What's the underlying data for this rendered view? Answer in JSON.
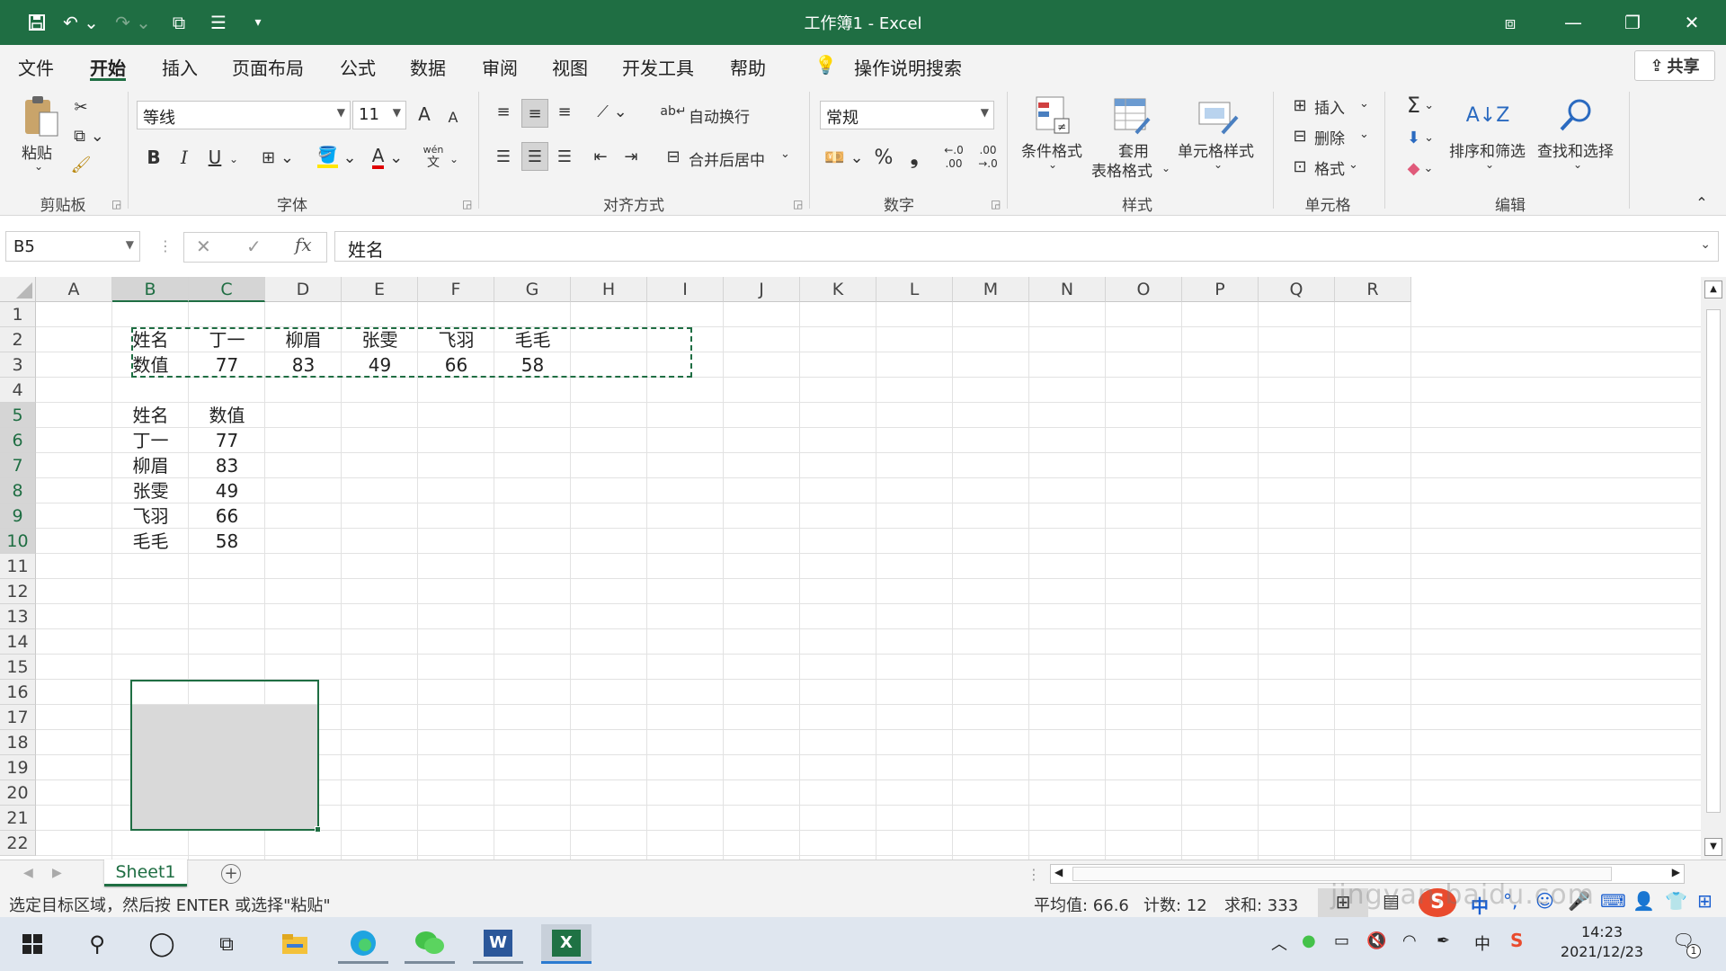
{
  "window": {
    "title": "工作簿1  -  Excel"
  },
  "tabs": [
    "文件",
    "开始",
    "插入",
    "页面布局",
    "公式",
    "数据",
    "审阅",
    "视图",
    "开发工具",
    "帮助"
  ],
  "active_tab": "开始",
  "tell_me": "操作说明搜索",
  "share_label": "共享",
  "ribbon": {
    "clipboard": {
      "paste": "粘贴",
      "group": "剪贴板"
    },
    "font": {
      "name": "等线",
      "size": "11",
      "group": "字体",
      "bold": "B",
      "italic": "I",
      "underline": "U",
      "grow": "A",
      "shrink": "A",
      "color_a": "A",
      "phonetic": "wén",
      "phonetic_sub": "文"
    },
    "alignment": {
      "wrap": "自动换行",
      "merge": "合并后居中",
      "group": "对齐方式"
    },
    "number": {
      "format": "常规",
      "percent": "%",
      "comma": "❟",
      "inc_dec_top": "←.0",
      "inc_dec_bot": ".00",
      "dec_dec_top": ".00",
      "dec_dec_bot": "→.0",
      "group": "数字"
    },
    "styles": {
      "conditional": "条件格式",
      "table_l1": "套用",
      "table_l2": "表格格式",
      "cell_styles": "单元格样式",
      "group": "样式"
    },
    "cells": {
      "insert": "插入",
      "delete": "删除",
      "format": "格式",
      "group": "单元格"
    },
    "editing": {
      "sort": "排序和筛选",
      "find": "查找和选择",
      "group": "编辑",
      "sigma": "Σ"
    }
  },
  "formula_bar": {
    "name_box": "B5",
    "cancel": "✕",
    "enter": "✓",
    "fx": "fx",
    "value": "姓名"
  },
  "columns": [
    "A",
    "B",
    "C",
    "D",
    "E",
    "F",
    "G",
    "H",
    "I",
    "J",
    "K",
    "L",
    "M",
    "N",
    "O",
    "P",
    "Q",
    "R"
  ],
  "rows": [
    "1",
    "2",
    "3",
    "4",
    "5",
    "6",
    "7",
    "8",
    "9",
    "10",
    "11",
    "12",
    "13",
    "14",
    "15",
    "16",
    "17",
    "18",
    "19",
    "20",
    "21",
    "22"
  ],
  "row_table": {
    "header": [
      "姓名",
      "丁一",
      "柳眉",
      "张雯",
      "飞羽",
      "毛毛"
    ],
    "values": [
      "数值",
      "77",
      "83",
      "49",
      "66",
      "58"
    ]
  },
  "col_table": {
    "header": [
      "姓名",
      "数值"
    ],
    "rows": [
      [
        "丁一",
        "77"
      ],
      [
        "柳眉",
        "83"
      ],
      [
        "张雯",
        "49"
      ],
      [
        "飞羽",
        "66"
      ],
      [
        "毛毛",
        "58"
      ]
    ]
  },
  "sheet": {
    "tab": "Sheet1",
    "add": "+"
  },
  "status": {
    "message": "选定目标区域，然后按 ENTER 或选择\"粘贴\"",
    "average": "平均值: 66.6",
    "count": "计数: 12",
    "sum": "求和: 333"
  },
  "ime": {
    "lang": "中"
  },
  "watermark": "jingyan.baidu.com",
  "clock": {
    "time": "14:23",
    "date": "2021/12/23"
  },
  "notifications": "1",
  "taskbar_lang": "中"
}
